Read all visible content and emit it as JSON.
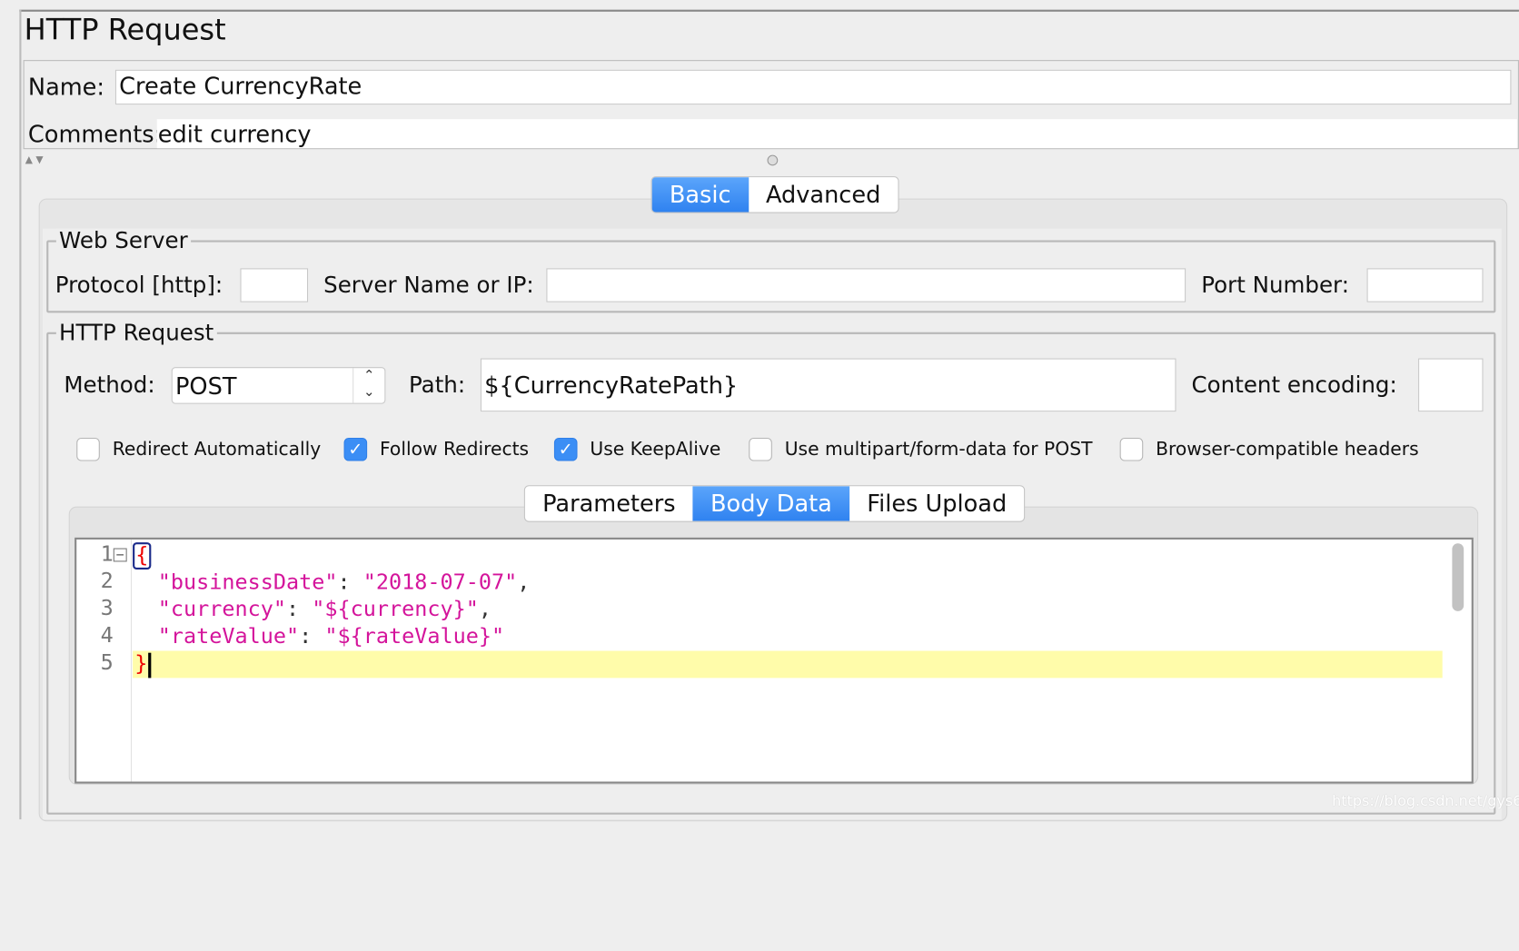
{
  "title": "HTTP Request",
  "name": {
    "label": "Name:",
    "value": "Create CurrencyRate"
  },
  "comments": {
    "label": "Comments:",
    "value": "edit currency"
  },
  "main_tabs": [
    {
      "label": "Basic",
      "active": true
    },
    {
      "label": "Advanced",
      "active": false
    }
  ],
  "web_server": {
    "legend": "Web Server",
    "protocol_label": "Protocol [http]:",
    "protocol_value": "",
    "server_label": "Server Name or IP:",
    "server_value": "",
    "port_label": "Port Number:",
    "port_value": ""
  },
  "http_request": {
    "legend": "HTTP Request",
    "method_label": "Method:",
    "method_value": "POST",
    "path_label": "Path:",
    "path_value": "${CurrencyRatePath}",
    "encoding_label": "Content encoding:",
    "encoding_value": ""
  },
  "checkboxes": [
    {
      "label": "Redirect Automatically",
      "checked": false
    },
    {
      "label": "Follow Redirects",
      "checked": true
    },
    {
      "label": "Use KeepAlive",
      "checked": true
    },
    {
      "label": "Use multipart/form-data for POST",
      "checked": false
    },
    {
      "label": "Browser-compatible headers",
      "checked": false
    }
  ],
  "sub_tabs": [
    {
      "label": "Parameters",
      "active": false
    },
    {
      "label": "Body Data",
      "active": true
    },
    {
      "label": "Files Upload",
      "active": false
    }
  ],
  "body_lines": [
    {
      "n": "1",
      "key": "",
      "val": "",
      "open": "{"
    },
    {
      "n": "2",
      "key": "\"businessDate\"",
      "val": "\"2018-07-07\"",
      "sep": ","
    },
    {
      "n": "3",
      "key": "\"currency\"",
      "val": "\"${currency}\"",
      "sep": ","
    },
    {
      "n": "4",
      "key": "\"rateValue\"",
      "val": "\"${rateValue}\"",
      "sep": ""
    },
    {
      "n": "5",
      "close": "}"
    }
  ],
  "watermark": "https://blog.csdn.net/gys686",
  "colors": {
    "accent": "#3b8ef5",
    "string": "#d4149b",
    "bracket": "#ee0000",
    "current_line": "#fffcaa"
  }
}
